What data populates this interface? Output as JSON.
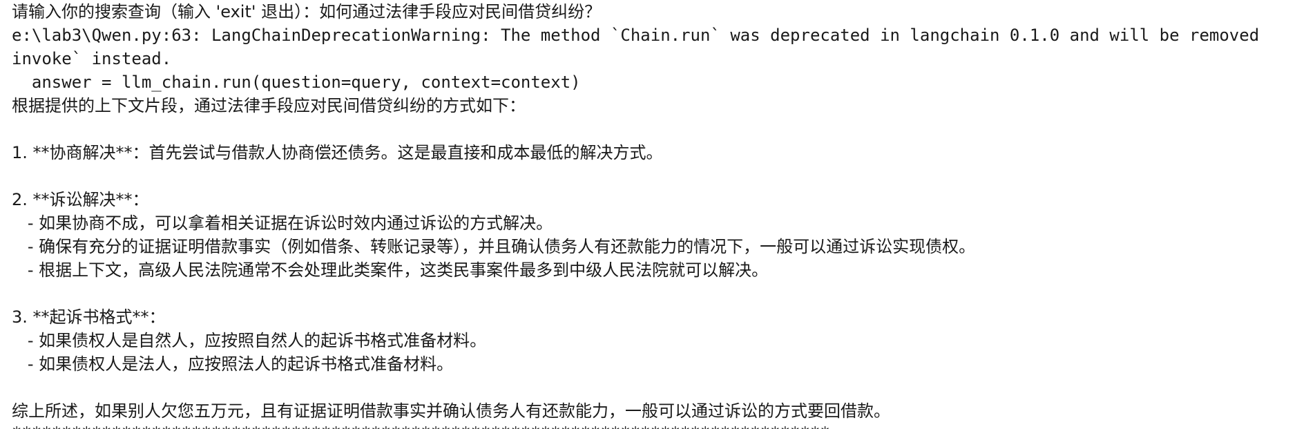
{
  "terminal": {
    "lines": [
      "请输入你的搜索查询（输入 'exit' 退出）：如何通过法律手段应对民间借贷纠纷？",
      "e:\\lab3\\Qwen.py:63: LangChainDeprecationWarning: The method `Chain.run` was deprecated in langchain 0.1.0 and will be removed",
      "invoke` instead.",
      "  answer = llm_chain.run(question=query, context=context)",
      "根据提供的上下文片段，通过法律手段应对民间借贷纠纷的方式如下：",
      "",
      "1. **协商解决**：首先尝试与借款人协商偿还债务。这是最直接和成本最低的解决方式。",
      "",
      "2. **诉讼解决**：",
      "   - 如果协商不成，可以拿着相关证据在诉讼时效内通过诉讼的方式解决。",
      "   - 确保有充分的证据证明借款事实（例如借条、转账记录等），并且确认债务人有还款能力的情况下，一般可以通过诉讼实现债权。",
      "   - 根据上下文，高级人民法院通常不会处理此类案件，这类民事案件最多到中级人民法院就可以解决。",
      "",
      "3. **起诉书格式**：",
      "   - 如果债权人是自然人，应按照自然人的起诉书格式准备材料。",
      "   - 如果债权人是法人，应按照法人的起诉书格式准备材料。",
      "",
      "综上所述，如果别人欠您五万元，且有证据证明借款事实并确认债务人有还款能力，一般可以通过诉讼的方式要回借款。",
      "**********************************************************************************"
    ]
  }
}
